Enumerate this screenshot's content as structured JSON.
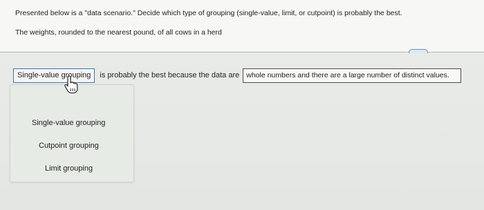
{
  "question": {
    "line1": "Presented below is a \"data scenario.\" Decide which type of grouping (single-value, limit, or cutpoint) is probably the best.",
    "line2": "The weights, rounded to the nearest pound, of all cows in a herd"
  },
  "expand_pill": "....",
  "answer": {
    "dropdown_value": "Single-value grouping",
    "connector": "is probably the best because the data are",
    "reason_value": "whole numbers and there are a large number of distinct values."
  },
  "dropdown_options": [
    "Single-value grouping",
    "Cutpoint grouping",
    "Limit grouping"
  ],
  "cursor": "hand-pointer-icon"
}
